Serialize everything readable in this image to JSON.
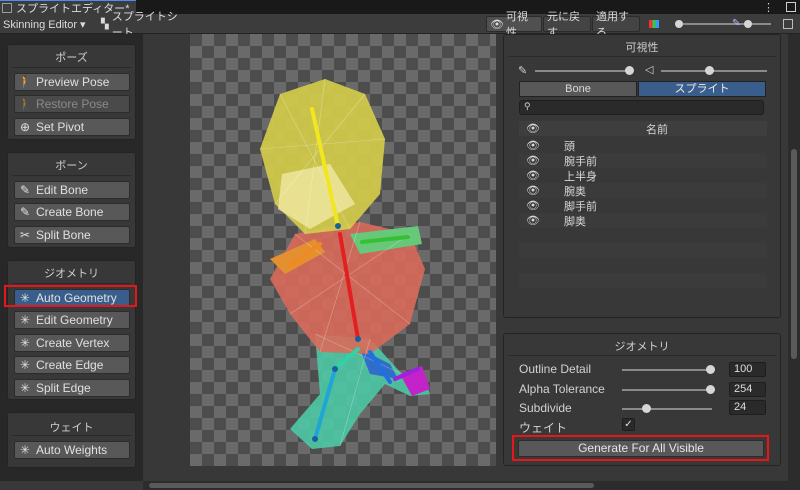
{
  "window": {
    "tab_title": "スプライトエディター*",
    "menu_icon": "kebab-icon",
    "extra_icon": "stack-icon"
  },
  "toolbar": {
    "mode_dropdown": "Skinning Editor ▾",
    "sprite_sheet": "スプライトシート",
    "visibility": "可視性",
    "revert": "元に戻す",
    "apply": "適用する"
  },
  "left_panel": {
    "pose": {
      "title": "ポーズ",
      "buttons": [
        "Preview Pose",
        "Restore Pose",
        "Set Pivot"
      ]
    },
    "bone": {
      "title": "ボーン",
      "buttons": [
        "Edit Bone",
        "Create Bone",
        "Split Bone"
      ]
    },
    "geometry": {
      "title": "ジオメトリ",
      "buttons": [
        "Auto Geometry",
        "Edit Geometry",
        "Create Vertex",
        "Create Edge",
        "Split Edge"
      ]
    },
    "weight": {
      "title": "ウェイト",
      "buttons": [
        "Auto Weights"
      ]
    }
  },
  "visibility_panel": {
    "title": "可視性",
    "tabs": [
      "Bone",
      "スプライト"
    ],
    "active_tab": "スプライト",
    "search_placeholder": "",
    "column_header": "名前",
    "layers": [
      "頭",
      "腕手前",
      "上半身",
      "腕奥",
      "脚手前",
      "脚奥"
    ]
  },
  "geometry_panel": {
    "title": "ジオメトリ",
    "fields": [
      {
        "label": "Outline Detail",
        "value": "100",
        "level": 1.0
      },
      {
        "label": "Alpha Tolerance",
        "value": "254",
        "level": 1.0
      },
      {
        "label": "Subdivide",
        "value": "24",
        "level": 0.24
      }
    ],
    "weight_label": "ウェイト",
    "weight_checked": true,
    "generate_button": "Generate For All Visible"
  },
  "colors": {
    "accent": "#3a5e8c",
    "highlight": "#e8161a",
    "bg": "#383838"
  }
}
